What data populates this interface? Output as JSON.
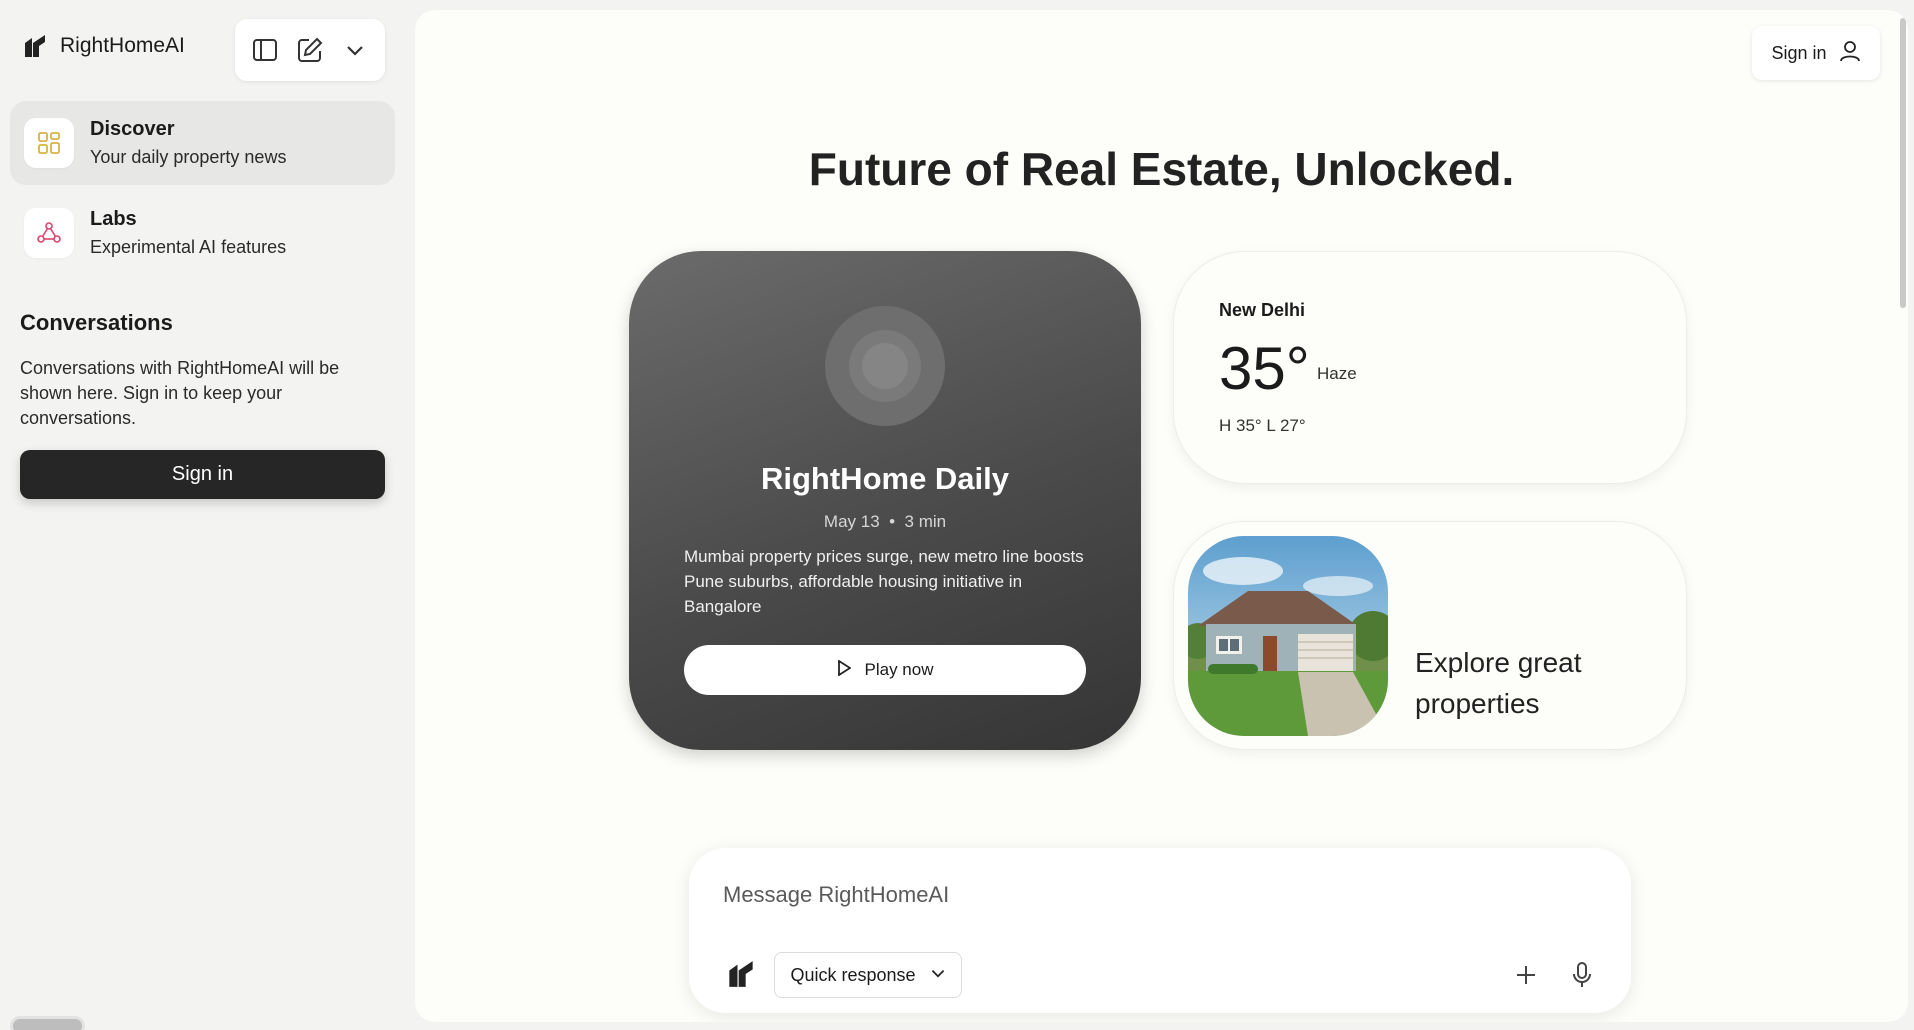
{
  "sidebar": {
    "brand_name": "RightHomeAI",
    "toolbar": {
      "icons": [
        "sidebar-toggle-icon",
        "new-chat-icon",
        "chevron-down-icon"
      ]
    },
    "nav": [
      {
        "title": "Discover",
        "subtitle": "Your daily property news",
        "icon": "grid-icon",
        "active": true
      },
      {
        "title": "Labs",
        "subtitle": "Experimental AI features",
        "icon": "labs-icon",
        "active": false
      }
    ],
    "conversations": {
      "title": "Conversations",
      "description": "Conversations with RightHomeAI will be shown here. Sign in to keep your conversations.",
      "signin_label": "Sign in"
    }
  },
  "header": {
    "signin_label": "Sign in"
  },
  "main": {
    "headline": "Future of Real Estate, Unlocked.",
    "daily": {
      "title": "RightHome Daily",
      "date": "May 13",
      "duration": "3 min",
      "separator": "•",
      "description": "Mumbai property prices surge, new metro line boosts Pune suburbs, affordable housing initiative in Bangalore",
      "play_label": "Play now"
    },
    "weather": {
      "city": "New Delhi",
      "temperature": "35°",
      "condition": "Haze",
      "high_low": "H 35° L 27°"
    },
    "explore": {
      "label": "Explore great properties"
    }
  },
  "chat": {
    "placeholder": "Message RightHomeAI",
    "mode_label": "Quick response"
  },
  "colors": {
    "page_bg": "#f3f3f1",
    "panel_bg": "#fdfdf9",
    "dark_button": "#262626",
    "discover_accent": "#d8b24a",
    "labs_accent": "#d9446a"
  }
}
